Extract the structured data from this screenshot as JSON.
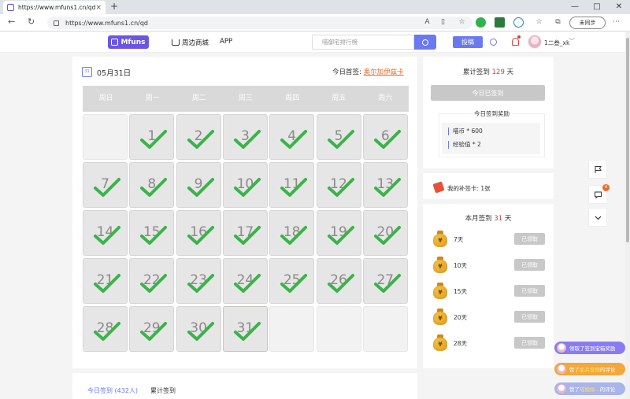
{
  "browser": {
    "tab_title": "https://www.mfuns1.cn/qd",
    "url": "https://www.mfuns1.cn/qd",
    "sync_label": "未同步",
    "new_tab": "+",
    "tab_close": "×",
    "win_min": "—",
    "win_max": "□",
    "win_close": "✕",
    "back": "←",
    "refresh": "↻"
  },
  "header": {
    "logo": "Mfuns",
    "nav": [
      "周边商城",
      "APP"
    ],
    "search_placeholder": "喵御宅排行榜",
    "post_label": "投稿",
    "username": "1二叁_xk",
    "caret": "﹀"
  },
  "calendar": {
    "date_label": "05月31日",
    "icon_text": "31",
    "first_signin_label": "今日首签:",
    "first_signin_user": "奥尔加伊兹卡",
    "weekdays": [
      "周日",
      "周一",
      "周二",
      "周三",
      "周四",
      "周五",
      "周六"
    ],
    "first_weekday_index": 1,
    "days_in_month": 31,
    "today": 31,
    "checked_days": [
      1,
      2,
      3,
      4,
      5,
      6,
      7,
      8,
      9,
      10,
      11,
      12,
      13,
      14,
      15,
      16,
      17,
      18,
      19,
      20,
      21,
      22,
      23,
      24,
      25,
      26,
      27,
      28,
      29,
      30,
      31
    ],
    "check_color": "#3bb34a"
  },
  "tabs": {
    "today_tab": "今日签到 (432人)",
    "total_tab": "累计签到"
  },
  "side": {
    "total_prefix": "累计签到",
    "total_days": "129",
    "total_suffix": "天",
    "signed_button": "今日已签到",
    "reward_title": "今日签到奖励",
    "rewards": [
      "喵币 * 600",
      "经验值 * 2"
    ],
    "card_text": "我的补签卡: 1张",
    "month_prefix": "本月签到",
    "month_days": "31",
    "month_suffix": "天",
    "milestones": [
      {
        "days": "7天",
        "status": "已领取"
      },
      {
        "days": "10天",
        "status": "已领取"
      },
      {
        "days": "15天",
        "status": "已领取"
      },
      {
        "days": "20天",
        "status": "已领取"
      },
      {
        "days": "28天",
        "status": "已领取"
      }
    ],
    "bag_symbol": "¥"
  },
  "floating": {
    "comment_badge": "4"
  },
  "toasts": [
    {
      "prefix": "领取了签到宝箱奖励",
      "highlight": "",
      "suffix": "",
      "color": "#8a7cf0"
    },
    {
      "prefix": "赞了 ",
      "highlight": "肌兵爱丽",
      "suffix": " 的评论",
      "color": "#f4a73a"
    },
    {
      "prefix": "赞了 ",
      "highlight": "喵娘娘...",
      "suffix": " 的评论",
      "color": "#a9b4e8"
    }
  ]
}
